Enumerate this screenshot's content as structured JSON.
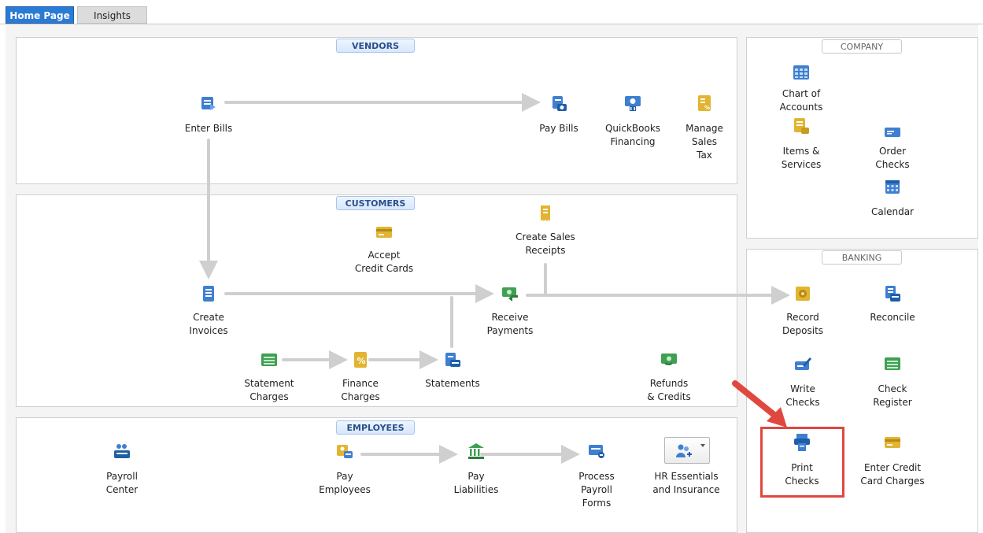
{
  "tabs": [
    {
      "label": "Home Page"
    },
    {
      "label": "Insights"
    }
  ],
  "sections": {
    "vendors": "VENDORS",
    "customers": "CUSTOMERS",
    "employees": "EMPLOYEES",
    "company": "COMPANY",
    "banking": "BANKING"
  },
  "vendors": {
    "enter_bills": "Enter Bills",
    "pay_bills": "Pay Bills",
    "quickbooks_financing": "QuickBooks\nFinancing",
    "manage_sales_tax": "Manage\nSales\nTax"
  },
  "customers": {
    "accept_credit_cards": "Accept\nCredit Cards",
    "create_sales_receipts": "Create Sales\nReceipts",
    "create_invoices": "Create\nInvoices",
    "receive_payments": "Receive\nPayments",
    "statement_charges": "Statement\nCharges",
    "finance_charges": "Finance\nCharges",
    "statements": "Statements",
    "refunds_credits": "Refunds\n& Credits"
  },
  "employees": {
    "payroll_center": "Payroll\nCenter",
    "pay_employees": "Pay\nEmployees",
    "pay_liabilities": "Pay\nLiabilities",
    "process_payroll_forms": "Process\nPayroll\nForms",
    "hr_essentials": "HR Essentials\nand Insurance"
  },
  "company": {
    "chart_of_accounts": "Chart of\nAccounts",
    "items_services": "Items &\nServices",
    "order_checks": "Order\nChecks",
    "calendar": "Calendar"
  },
  "banking": {
    "record_deposits": "Record\nDeposits",
    "reconcile": "Reconcile",
    "write_checks": "Write\nChecks",
    "check_register": "Check\nRegister",
    "print_checks": "Print\nChecks",
    "enter_credit_card_charges": "Enter Credit\nCard Charges"
  },
  "colors": {
    "tab_active": "#2a7bd5",
    "flow_line": "#cfcfcf",
    "highlight": "#e0483f",
    "icon_blue": "#3f7fd0",
    "icon_gold": "#e2b431",
    "icon_green": "#3fa052"
  }
}
